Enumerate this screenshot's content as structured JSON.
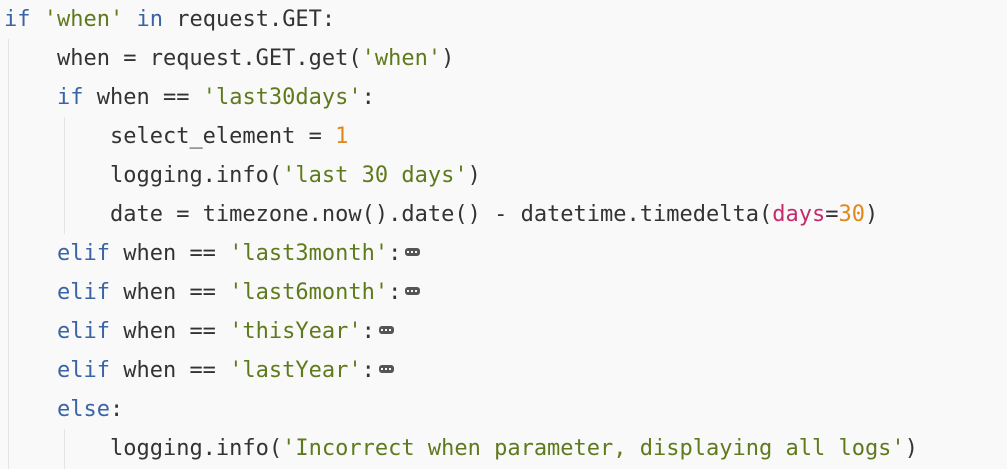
{
  "code_lines": [
    {
      "indent": "",
      "tokens": [
        [
          "kw",
          "if"
        ],
        [
          "plain",
          " "
        ],
        [
          "str",
          "'when'"
        ],
        [
          "plain",
          " "
        ],
        [
          "kw",
          "in"
        ],
        [
          "plain",
          " request.GET:"
        ]
      ]
    },
    {
      "indent": "    ",
      "tokens": [
        [
          "plain",
          "when = request.GET.get("
        ],
        [
          "str",
          "'when'"
        ],
        [
          "plain",
          ")"
        ]
      ]
    },
    {
      "indent": "    ",
      "tokens": [
        [
          "kw",
          "if"
        ],
        [
          "plain",
          " when == "
        ],
        [
          "str",
          "'last30days'"
        ],
        [
          "plain",
          ":"
        ]
      ]
    },
    {
      "indent": "        ",
      "tokens": [
        [
          "plain",
          "select_element = "
        ],
        [
          "num",
          "1"
        ]
      ]
    },
    {
      "indent": "        ",
      "tokens": [
        [
          "plain",
          "logging.info("
        ],
        [
          "str",
          "'last 30 days'"
        ],
        [
          "plain",
          ")"
        ]
      ]
    },
    {
      "indent": "        ",
      "tokens": [
        [
          "plain",
          "date = timezone.now().date() - datetime.timedelta("
        ],
        [
          "param",
          "days"
        ],
        [
          "plain",
          "="
        ],
        [
          "num",
          "30"
        ],
        [
          "plain",
          ")"
        ]
      ]
    },
    {
      "indent": "    ",
      "tokens": [
        [
          "kw",
          "elif"
        ],
        [
          "plain",
          " when == "
        ],
        [
          "str",
          "'last3month'"
        ],
        [
          "plain",
          ":"
        ]
      ],
      "folded": true
    },
    {
      "indent": "    ",
      "tokens": [
        [
          "kw",
          "elif"
        ],
        [
          "plain",
          " when == "
        ],
        [
          "str",
          "'last6month'"
        ],
        [
          "plain",
          ":"
        ]
      ],
      "folded": true
    },
    {
      "indent": "    ",
      "tokens": [
        [
          "kw",
          "elif"
        ],
        [
          "plain",
          " when == "
        ],
        [
          "str",
          "'thisYear'"
        ],
        [
          "plain",
          ":"
        ]
      ],
      "folded": true
    },
    {
      "indent": "    ",
      "tokens": [
        [
          "kw",
          "elif"
        ],
        [
          "plain",
          " when == "
        ],
        [
          "str",
          "'lastYear'"
        ],
        [
          "plain",
          ":"
        ]
      ],
      "folded": true
    },
    {
      "indent": "    ",
      "tokens": [
        [
          "kw",
          "else"
        ],
        [
          "plain",
          ":"
        ]
      ]
    },
    {
      "indent": "        ",
      "tokens": [
        [
          "plain",
          "logging.info("
        ],
        [
          "str",
          "'Incorrect when parameter, displaying all logs'"
        ],
        [
          "plain",
          ")"
        ]
      ]
    }
  ],
  "colors": {
    "background": "#f9f9f9",
    "keyword": "#3a64a6",
    "string": "#5f7a1d",
    "number": "#e0891a",
    "parameter": "#c7296e",
    "text": "#333333"
  },
  "fold_icon": "fold-ellipsis-icon"
}
